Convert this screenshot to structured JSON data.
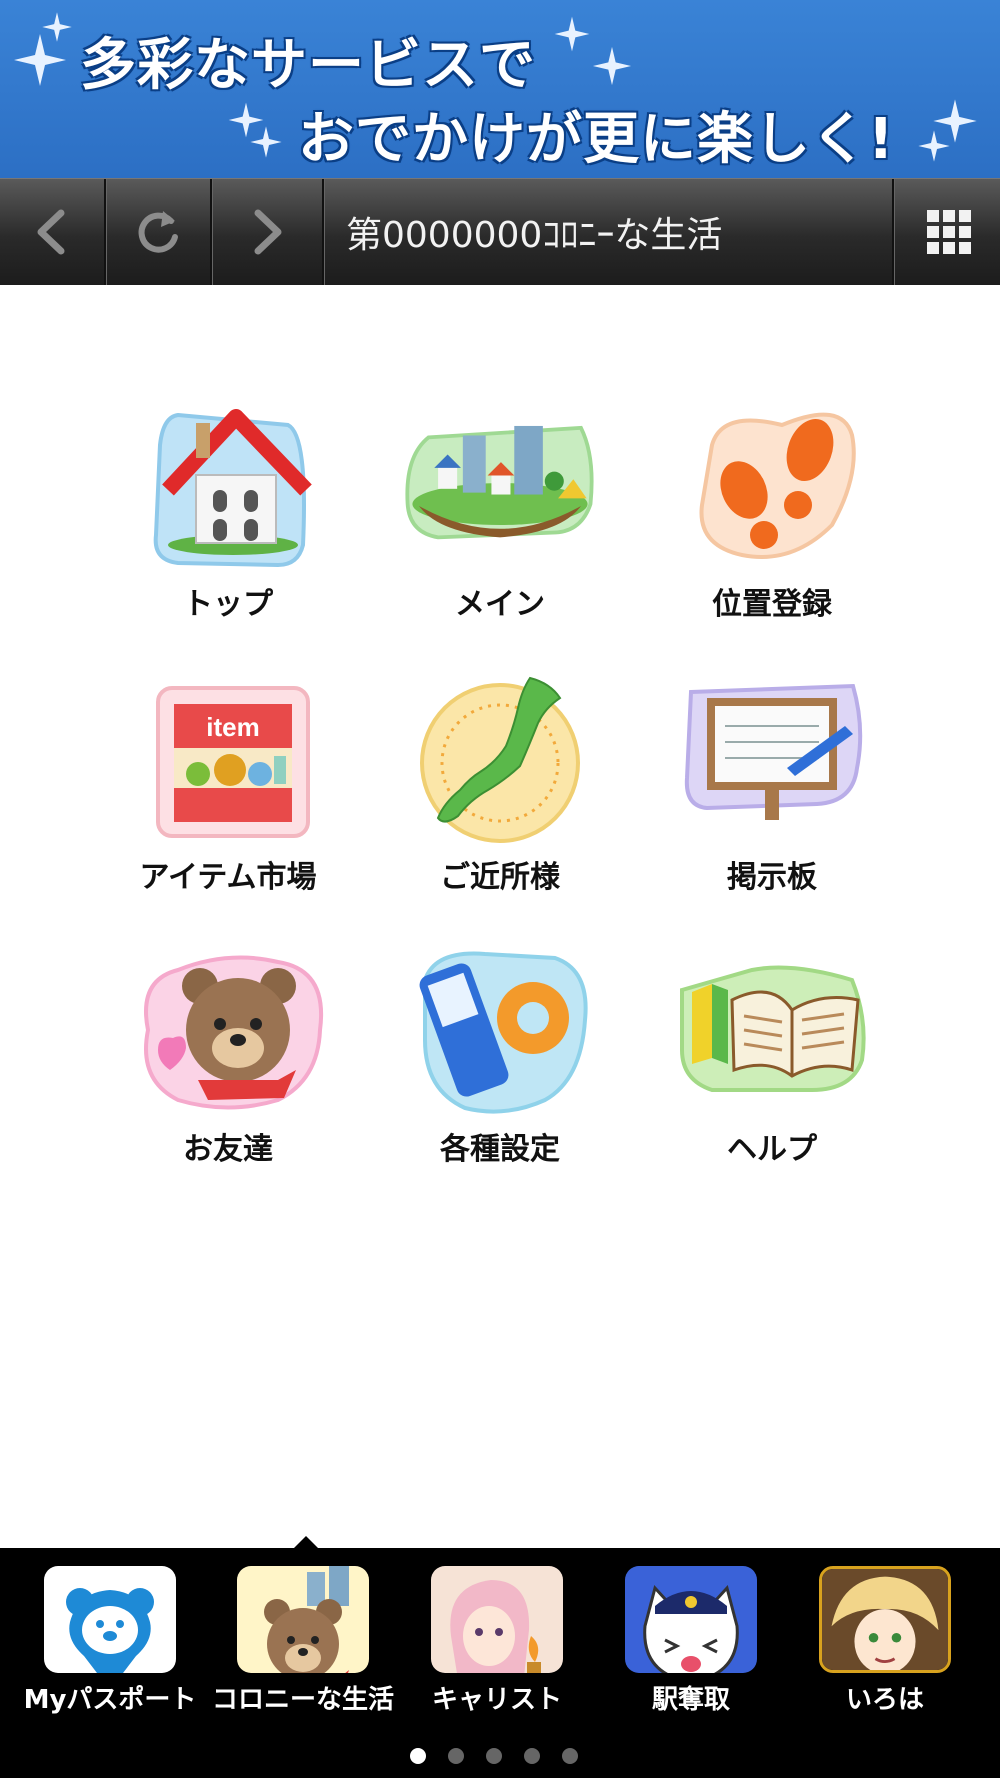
{
  "banner": {
    "line1": "多彩なサービスで",
    "line2": "おでかけが更に楽しく!",
    "background": "#2c6fc4"
  },
  "toolbar": {
    "back_icon": "chevron-left-icon",
    "reload_icon": "reload-icon",
    "forward_icon": "chevron-right-icon",
    "title": "第0000000ｺﾛﾆｰな生活",
    "menu_icon": "grid-menu-icon"
  },
  "menu": {
    "items": [
      {
        "label": "トップ",
        "icon": "house-icon"
      },
      {
        "label": "メイン",
        "icon": "town-island-icon"
      },
      {
        "label": "位置登録",
        "icon": "footprints-icon"
      },
      {
        "label": "アイテム市場",
        "icon": "item-shop-icon"
      },
      {
        "label": "ご近所様",
        "icon": "japan-map-icon"
      },
      {
        "label": "掲示板",
        "icon": "bulletin-board-icon"
      },
      {
        "label": "お友達",
        "icon": "bear-heart-icon"
      },
      {
        "label": "各種設定",
        "icon": "phone-gear-icon"
      },
      {
        "label": "ヘルプ",
        "icon": "open-book-icon"
      }
    ],
    "item_icon_text": "item"
  },
  "dock": {
    "apps": [
      {
        "label": "Myパスポート",
        "icon": "passport-bear-icon"
      },
      {
        "label": "コロニーな生活",
        "icon": "colony-bear-icon"
      },
      {
        "label": "キャリスト",
        "icon": "caristo-character-icon"
      },
      {
        "label": "駅奪取",
        "icon": "station-cat-icon"
      },
      {
        "label": "いろは",
        "icon": "iroha-character-icon"
      }
    ],
    "page_dots": 5,
    "active_page": 1
  }
}
